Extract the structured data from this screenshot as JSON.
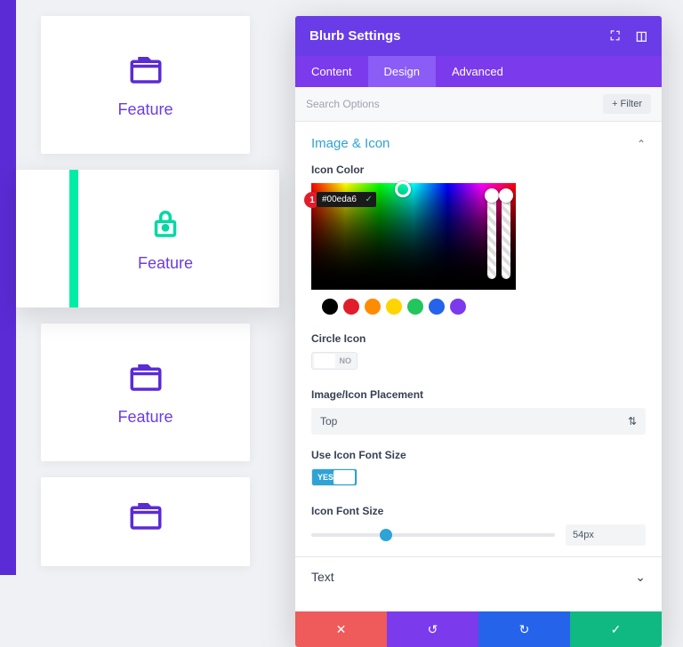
{
  "cards": [
    {
      "label": "Feature",
      "icon": "folder",
      "color": "#5b2bd5"
    },
    {
      "label": "Feature",
      "icon": "lock",
      "color": "#00d9a3"
    },
    {
      "label": "Feature",
      "icon": "folder",
      "color": "#5b2bd5"
    },
    {
      "label": "",
      "icon": "folder",
      "color": "#5b2bd5"
    }
  ],
  "panel": {
    "title": "Blurb Settings",
    "tabs": [
      "Content",
      "Design",
      "Advanced"
    ],
    "active_tab": "Design",
    "search_placeholder": "Search Options",
    "filter_label": "Filter"
  },
  "section": {
    "title": "Image & Icon",
    "icon_color_label": "Icon Color",
    "hex": "#00eda6",
    "marker": "1",
    "swatches": [
      "#000000",
      "#e11d2b",
      "#ff8c00",
      "#ffd400",
      "#22c55e",
      "#2563eb",
      "#7c3aed"
    ],
    "circle_icon_label": "Circle Icon",
    "circle_icon_value": "NO",
    "placement_label": "Image/Icon Placement",
    "placement_value": "Top",
    "use_font_size_label": "Use Icon Font Size",
    "use_font_size_value": "YES",
    "font_size_label": "Icon Font Size",
    "font_size_value": "54px"
  },
  "text_section": {
    "title": "Text"
  },
  "footer": {
    "cancel": "✕",
    "undo": "↺",
    "redo": "↻",
    "save": "✓"
  }
}
